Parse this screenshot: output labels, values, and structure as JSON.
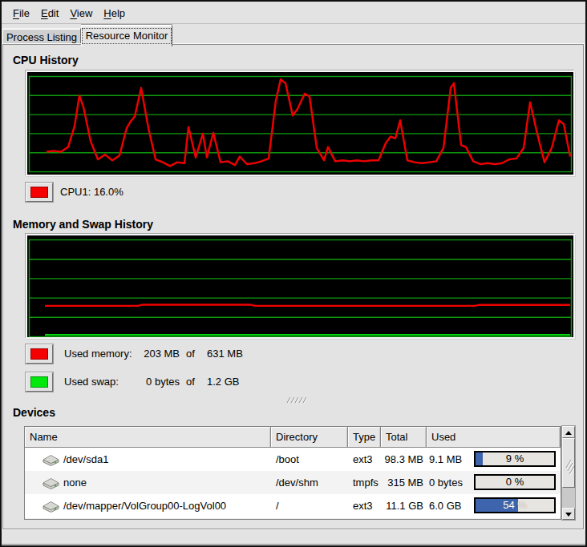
{
  "window": {
    "bg_color": "#e3e3e3",
    "scrollbar_icons": [
      "arrow-up-icon",
      "arrow-down-icon"
    ],
    "pane_grip_icon": "pane-resize-grip"
  },
  "menu": {
    "items": [
      {
        "label": "File",
        "mnemonic": "F"
      },
      {
        "label": "Edit",
        "mnemonic": "E"
      },
      {
        "label": "View",
        "mnemonic": "V"
      },
      {
        "label": "Help",
        "mnemonic": "H"
      }
    ]
  },
  "tabs": [
    {
      "label": "Process Listing",
      "active": false
    },
    {
      "label": "Resource Monitor",
      "active": true
    }
  ],
  "cpu_section": {
    "title": "CPU History",
    "legend": {
      "swatch_color": "#f40000",
      "label": "CPU1: 16.0%"
    }
  },
  "memory_section": {
    "title": "Memory and Swap History",
    "legend_rows": [
      {
        "swatch_color": "#f40000",
        "label": "Used memory:",
        "used": "203 MB",
        "of_word": "of",
        "total": "631 MB"
      },
      {
        "swatch_color": "#00e80c",
        "label": "Used swap:",
        "used": "0 bytes",
        "of_word": "of",
        "total": "1.2 GB"
      }
    ]
  },
  "devices": {
    "title": "Devices",
    "bar_color": "#3d64ad",
    "row_icon": "harddisk-icon",
    "columns": [
      "Name",
      "Directory",
      "Type",
      "Total",
      "Used"
    ],
    "rows": [
      {
        "icon": "harddisk-icon",
        "name": "/dev/sda1",
        "directory": "/boot",
        "type": "ext3",
        "total": "98.3 MB",
        "used": "9.1 MB",
        "percent": 9,
        "percent_label": "9 %"
      },
      {
        "icon": "harddisk-icon",
        "name": "none",
        "directory": "/dev/shm",
        "type": "tmpfs",
        "total": "315 MB",
        "used": "0 bytes",
        "percent": 0,
        "percent_label": "0 %"
      },
      {
        "icon": "harddisk-icon",
        "name": "/dev/mapper/VolGroup00-LogVol00",
        "directory": "/",
        "type": "ext3",
        "total": "11.1 GB",
        "used": "6.0 GB",
        "percent": 54,
        "percent_label": "54 %"
      }
    ]
  },
  "chart_data": [
    {
      "type": "line",
      "title": "CPU History",
      "series": [
        {
          "name": "CPU1",
          "color": "#ef0000",
          "unit": "percent",
          "points": [
            [
              58,
              21
            ],
            [
              67,
              22
            ],
            [
              76,
              21
            ],
            [
              85,
              26
            ],
            [
              93,
              48
            ],
            [
              99,
              80
            ],
            [
              104,
              68
            ],
            [
              113,
              32
            ],
            [
              122,
              13
            ],
            [
              131,
              18
            ],
            [
              140,
              12
            ],
            [
              149,
              17
            ],
            [
              158,
              46
            ],
            [
              163,
              53
            ],
            [
              168,
              58
            ],
            [
              176,
              88
            ],
            [
              185,
              46
            ],
            [
              194,
              13
            ],
            [
              203,
              10
            ],
            [
              212,
              6
            ],
            [
              221,
              10
            ],
            [
              230,
              9
            ],
            [
              235,
              47
            ],
            [
              244,
              15
            ],
            [
              253,
              40
            ],
            [
              258,
              15
            ],
            [
              266,
              41
            ],
            [
              275,
              10
            ],
            [
              284,
              11
            ],
            [
              293,
              7
            ],
            [
              299,
              16
            ],
            [
              308,
              8
            ],
            [
              317,
              9
            ],
            [
              326,
              11
            ],
            [
              335,
              14
            ],
            [
              344,
              75
            ],
            [
              350,
              97
            ],
            [
              356,
              93
            ],
            [
              365,
              59
            ],
            [
              371,
              66
            ],
            [
              380,
              82
            ],
            [
              386,
              79
            ],
            [
              395,
              25
            ],
            [
              404,
              12
            ],
            [
              409,
              26
            ],
            [
              418,
              11
            ],
            [
              427,
              12
            ],
            [
              436,
              11
            ],
            [
              445,
              12
            ],
            [
              454,
              11
            ],
            [
              463,
              12
            ],
            [
              472,
              12
            ],
            [
              481,
              30
            ],
            [
              487,
              37
            ],
            [
              493,
              35
            ],
            [
              499,
              54
            ],
            [
              508,
              12
            ],
            [
              517,
              10
            ],
            [
              526,
              9
            ],
            [
              535,
              10
            ],
            [
              544,
              11
            ],
            [
              553,
              25
            ],
            [
              562,
              88
            ],
            [
              566,
              93
            ],
            [
              575,
              28
            ],
            [
              581,
              26
            ],
            [
              590,
              11
            ],
            [
              599,
              8
            ],
            [
              608,
              9
            ],
            [
              617,
              8
            ],
            [
              626,
              9
            ],
            [
              635,
              13
            ],
            [
              644,
              14
            ],
            [
              653,
              25
            ],
            [
              661,
              73
            ],
            [
              670,
              40
            ],
            [
              679,
              10
            ],
            [
              688,
              25
            ],
            [
              697,
              54
            ],
            [
              703,
              50
            ],
            [
              711,
              16
            ]
          ]
        }
      ],
      "ylim": [
        0,
        100
      ],
      "grid_lines": 4,
      "grid_color": "#0f9b0f",
      "current_value": "16.0%"
    },
    {
      "type": "line",
      "title": "Memory and Swap History",
      "series": [
        {
          "name": "Used memory",
          "color": "#ef0000",
          "unit": "percent",
          "points": [
            [
              56,
              31.9
            ],
            [
              172,
              31.9
            ],
            [
              178,
              33.1
            ],
            [
              312,
              33.1
            ],
            [
              318,
              31.9
            ],
            [
              592,
              31.9
            ],
            [
              598,
              32.9
            ],
            [
              711,
              32.9
            ]
          ]
        },
        {
          "name": "Used swap",
          "color": "#00d50b",
          "unit": "percent",
          "points": [
            [
              56,
              2
            ],
            [
              711,
              2
            ]
          ]
        }
      ],
      "ylim": [
        0,
        100
      ],
      "grid_lines": 4,
      "grid_color": "#0f9b0f",
      "current_values": {
        "memory": "203 MB of 631 MB",
        "swap": "0 bytes of 1.2 GB"
      }
    }
  ]
}
